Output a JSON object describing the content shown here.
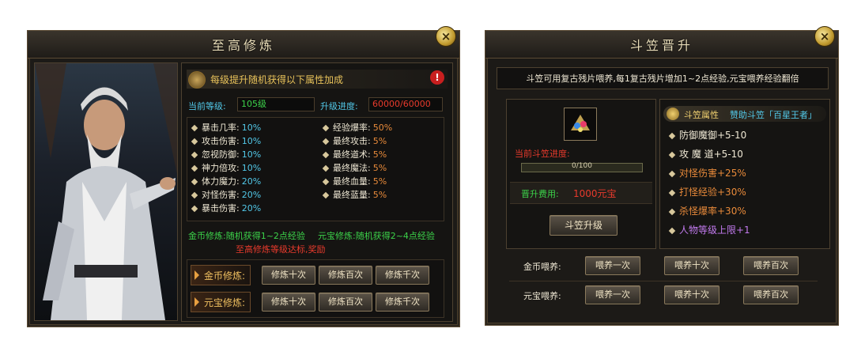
{
  "left_panel": {
    "title": "至高修炼",
    "close_icon": "×",
    "banner_text": "每级提升随机获得以下属性加成",
    "warning_icon": "!",
    "level_label": "当前等级:",
    "level_value": "105级",
    "progress_label": "升级进度:",
    "progress_value": "60000/60000",
    "attrs_left": [
      {
        "label": "暴击几率:",
        "value": "10%"
      },
      {
        "label": "攻击伤害:",
        "value": "10%"
      },
      {
        "label": "忽视防御:",
        "value": "10%"
      },
      {
        "label": "神力倍攻:",
        "value": "10%"
      },
      {
        "label": "体力魔力:",
        "value": "20%"
      },
      {
        "label": "对怪伤害:",
        "value": "20%"
      },
      {
        "label": "暴击伤害:",
        "value": "20%"
      }
    ],
    "attrs_right": [
      {
        "label": "经验爆率:",
        "value": "50%"
      },
      {
        "label": "最终攻击:",
        "value": "5%"
      },
      {
        "label": "最终道术:",
        "value": "5%"
      },
      {
        "label": "最终魔法:",
        "value": "5%"
      },
      {
        "label": "最终血量:",
        "value": "5%"
      },
      {
        "label": "最终蓝量:",
        "value": "5%"
      }
    ],
    "gold_note": "金币修炼:随机获得1~2点经验",
    "ingot_note": "元宝修炼:随机获得2~4点经验",
    "reward_note": "至高修炼等级达标,奖励",
    "gold_row_label": "金币修炼:",
    "ingot_row_label": "元宝修炼:",
    "buttons": [
      "修炼十次",
      "修炼百次",
      "修炼千次"
    ]
  },
  "right_panel": {
    "title": "斗笠晋升",
    "close_icon": "×",
    "info_text": "斗笠可用复古残片喂养,每1复古残片增加1~2点经验,元宝喂养经验翻倍",
    "progress_label": "当前斗笠进度:",
    "progress_value": "0/100",
    "progress_fraction": 0,
    "cost_label": "晋升费用:",
    "cost_value": "1000元宝",
    "upgrade_button": "斗笠升级",
    "attr_header_label": "斗笠属性",
    "attr_header_desc": "赞助斗笠「百星王者」",
    "attrs": [
      {
        "text": "防御魔御+5-10",
        "color": "#efe8d4"
      },
      {
        "text": "攻 魔 道+5-10",
        "color": "#efe8d4"
      },
      {
        "text": "对怪伤害+25%",
        "color": "#e88a3a"
      },
      {
        "text": "打怪经验+30%",
        "color": "#e88a3a"
      },
      {
        "text": "杀怪爆率+30%",
        "color": "#e88a3a"
      },
      {
        "text": "人物等级上限+1",
        "color": "#c27aee"
      }
    ],
    "gold_feed_label": "金币喂养:",
    "ingot_feed_label": "元宝喂养:",
    "gold_buttons": [
      "喂养一次",
      "喂养十次",
      "喂养百次"
    ],
    "ingot_buttons": [
      "喂养一次",
      "喂养十次",
      "喂养百次"
    ]
  }
}
